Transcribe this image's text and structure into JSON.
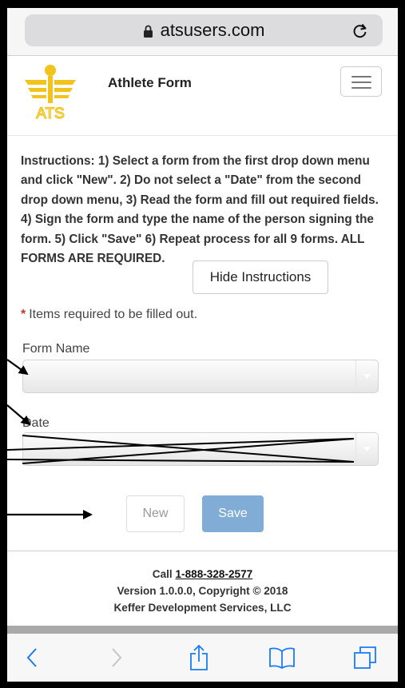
{
  "browser": {
    "url": "atsusers.com",
    "lock_icon": "lock-icon",
    "reload_icon": "reload-icon"
  },
  "header": {
    "logo_text": "ATS",
    "title": "Athlete Form",
    "menu_icon": "hamburger-menu-icon"
  },
  "instructions": {
    "text": "Instructions: 1) Select a form from the first drop down menu and click \"New\". 2) Do not select a \"Date\" from the second drop down menu, 3) Read the form and fill out required fields. 4) Sign the form and type the name of the person signing the form. 5) Click \"Save\" 6) Repeat process for all 9 forms. ALL FORMS ARE REQUIRED.",
    "hide_button": "Hide Instructions"
  },
  "required_note": {
    "star": "*",
    "text": "Items required to be filled out."
  },
  "form": {
    "form_name_label": "Form Name",
    "form_name_value": "",
    "date_label": "Date",
    "date_value": ""
  },
  "actions": {
    "new_label": "New",
    "save_label": "Save"
  },
  "footer": {
    "call_prefix": "Call",
    "phone": "1-888-328-2577",
    "version": "Version 1.0.0.0, Copyright © 2018",
    "company": "Keffer Development Services, LLC"
  },
  "toolbar": {
    "back_icon": "back-chevron-icon",
    "forward_icon": "forward-chevron-icon",
    "share_icon": "share-icon",
    "bookmarks_icon": "bookmarks-book-icon",
    "tabs_icon": "tabs-icon"
  },
  "colors": {
    "save_button": "#80acd6",
    "required_star": "#c0392b",
    "logo_gold": "#f2c31a",
    "ios_blue": "#1a7cf5"
  }
}
